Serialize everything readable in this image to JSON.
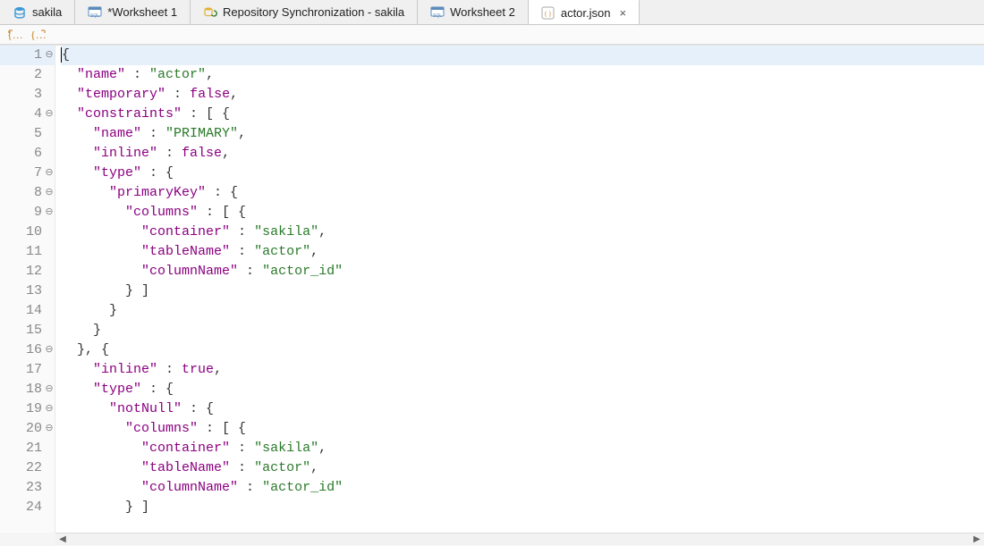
{
  "tabs": [
    {
      "label": "sakila",
      "icon": "db-icon",
      "active": false,
      "closeable": false
    },
    {
      "label": "*Worksheet 1",
      "icon": "sql-icon",
      "active": false,
      "closeable": false
    },
    {
      "label": "Repository Synchronization - sakila",
      "icon": "sync-icon",
      "active": false,
      "closeable": false
    },
    {
      "label": "Worksheet 2",
      "icon": "sql-icon",
      "active": false,
      "closeable": false
    },
    {
      "label": "actor.json",
      "icon": "json-icon",
      "active": true,
      "closeable": true
    }
  ],
  "toolbar": {
    "buttons": [
      "braces-expand-icon",
      "braces-collapse-icon"
    ]
  },
  "editor": {
    "cursor_line": 1,
    "lines": [
      {
        "n": 1,
        "fold": "minus",
        "indent": 0,
        "tokens": [
          [
            "p",
            "{"
          ]
        ]
      },
      {
        "n": 2,
        "fold": null,
        "indent": 1,
        "tokens": [
          [
            "k",
            "\"name\""
          ],
          [
            "p",
            " : "
          ],
          [
            "s",
            "\"actor\""
          ],
          [
            "p",
            ","
          ]
        ]
      },
      {
        "n": 3,
        "fold": null,
        "indent": 1,
        "tokens": [
          [
            "k",
            "\"temporary\""
          ],
          [
            "p",
            " : "
          ],
          [
            "b",
            "false"
          ],
          [
            "p",
            ","
          ]
        ]
      },
      {
        "n": 4,
        "fold": "minus",
        "indent": 1,
        "tokens": [
          [
            "k",
            "\"constraints\""
          ],
          [
            "p",
            " : [ {"
          ]
        ]
      },
      {
        "n": 5,
        "fold": null,
        "indent": 2,
        "tokens": [
          [
            "k",
            "\"name\""
          ],
          [
            "p",
            " : "
          ],
          [
            "s",
            "\"PRIMARY\""
          ],
          [
            "p",
            ","
          ]
        ]
      },
      {
        "n": 6,
        "fold": null,
        "indent": 2,
        "tokens": [
          [
            "k",
            "\"inline\""
          ],
          [
            "p",
            " : "
          ],
          [
            "b",
            "false"
          ],
          [
            "p",
            ","
          ]
        ]
      },
      {
        "n": 7,
        "fold": "minus",
        "indent": 2,
        "tokens": [
          [
            "k",
            "\"type\""
          ],
          [
            "p",
            " : {"
          ]
        ]
      },
      {
        "n": 8,
        "fold": "minus",
        "indent": 3,
        "tokens": [
          [
            "k",
            "\"primaryKey\""
          ],
          [
            "p",
            " : {"
          ]
        ]
      },
      {
        "n": 9,
        "fold": "minus",
        "indent": 4,
        "tokens": [
          [
            "k",
            "\"columns\""
          ],
          [
            "p",
            " : [ {"
          ]
        ]
      },
      {
        "n": 10,
        "fold": null,
        "indent": 5,
        "tokens": [
          [
            "k",
            "\"container\""
          ],
          [
            "p",
            " : "
          ],
          [
            "s",
            "\"sakila\""
          ],
          [
            "p",
            ","
          ]
        ]
      },
      {
        "n": 11,
        "fold": null,
        "indent": 5,
        "tokens": [
          [
            "k",
            "\"tableName\""
          ],
          [
            "p",
            " : "
          ],
          [
            "s",
            "\"actor\""
          ],
          [
            "p",
            ","
          ]
        ]
      },
      {
        "n": 12,
        "fold": null,
        "indent": 5,
        "tokens": [
          [
            "k",
            "\"columnName\""
          ],
          [
            "p",
            " : "
          ],
          [
            "s",
            "\"actor_id\""
          ]
        ]
      },
      {
        "n": 13,
        "fold": null,
        "indent": 4,
        "tokens": [
          [
            "p",
            "} ]"
          ]
        ]
      },
      {
        "n": 14,
        "fold": null,
        "indent": 3,
        "tokens": [
          [
            "p",
            "}"
          ]
        ]
      },
      {
        "n": 15,
        "fold": null,
        "indent": 2,
        "tokens": [
          [
            "p",
            "}"
          ]
        ]
      },
      {
        "n": 16,
        "fold": "minus",
        "indent": 1,
        "tokens": [
          [
            "p",
            "}, {"
          ]
        ]
      },
      {
        "n": 17,
        "fold": null,
        "indent": 2,
        "tokens": [
          [
            "k",
            "\"inline\""
          ],
          [
            "p",
            " : "
          ],
          [
            "b",
            "true"
          ],
          [
            "p",
            ","
          ]
        ]
      },
      {
        "n": 18,
        "fold": "minus",
        "indent": 2,
        "tokens": [
          [
            "k",
            "\"type\""
          ],
          [
            "p",
            " : {"
          ]
        ]
      },
      {
        "n": 19,
        "fold": "minus",
        "indent": 3,
        "tokens": [
          [
            "k",
            "\"notNull\""
          ],
          [
            "p",
            " : {"
          ]
        ]
      },
      {
        "n": 20,
        "fold": "minus",
        "indent": 4,
        "tokens": [
          [
            "k",
            "\"columns\""
          ],
          [
            "p",
            " : [ {"
          ]
        ]
      },
      {
        "n": 21,
        "fold": null,
        "indent": 5,
        "tokens": [
          [
            "k",
            "\"container\""
          ],
          [
            "p",
            " : "
          ],
          [
            "s",
            "\"sakila\""
          ],
          [
            "p",
            ","
          ]
        ]
      },
      {
        "n": 22,
        "fold": null,
        "indent": 5,
        "tokens": [
          [
            "k",
            "\"tableName\""
          ],
          [
            "p",
            " : "
          ],
          [
            "s",
            "\"actor\""
          ],
          [
            "p",
            ","
          ]
        ]
      },
      {
        "n": 23,
        "fold": null,
        "indent": 5,
        "tokens": [
          [
            "k",
            "\"columnName\""
          ],
          [
            "p",
            " : "
          ],
          [
            "s",
            "\"actor_id\""
          ]
        ]
      },
      {
        "n": 24,
        "fold": null,
        "indent": 4,
        "tokens": [
          [
            "p",
            "} ]"
          ]
        ]
      }
    ]
  },
  "scrollbar": {
    "left_arrow": "◀",
    "right_arrow": "▶"
  }
}
